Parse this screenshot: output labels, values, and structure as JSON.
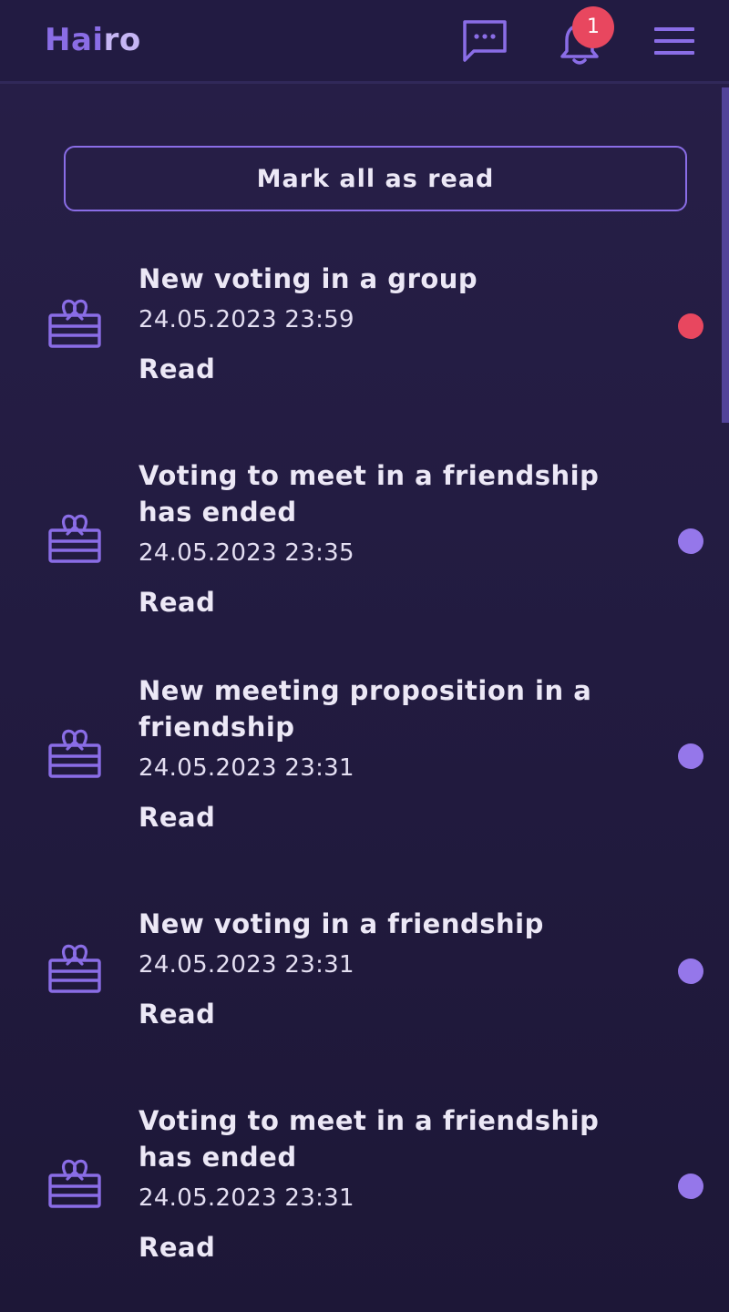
{
  "header": {
    "logo_part1": "Hai",
    "logo_part2": "ro",
    "notification_count": "1",
    "icons": [
      "chat-icon",
      "bell-icon",
      "menu-icon"
    ]
  },
  "actions": {
    "mark_all_label": "Mark all as read"
  },
  "colors": {
    "accent": "#8a6de6",
    "unread": "#e8475f",
    "read_dot": "#9577ea",
    "background": "#221b40"
  },
  "notifications": [
    {
      "title": "New voting in a group",
      "date": "24.05.2023 23:59",
      "action": "Read",
      "status": "unread",
      "icon": "gift-icon"
    },
    {
      "title": "Voting to meet in a friendship has ended",
      "date": "24.05.2023 23:35",
      "action": "Read",
      "status": "read",
      "icon": "gift-icon"
    },
    {
      "title": "New meeting proposition in a friendship",
      "date": "24.05.2023 23:31",
      "action": "Read",
      "status": "read",
      "icon": "gift-icon"
    },
    {
      "title": "New voting in a friendship",
      "date": "24.05.2023 23:31",
      "action": "Read",
      "status": "read",
      "icon": "gift-icon"
    },
    {
      "title": "Voting to meet in a friendship has ended",
      "date": "24.05.2023 23:31",
      "action": "Read",
      "status": "read",
      "icon": "gift-icon"
    }
  ]
}
